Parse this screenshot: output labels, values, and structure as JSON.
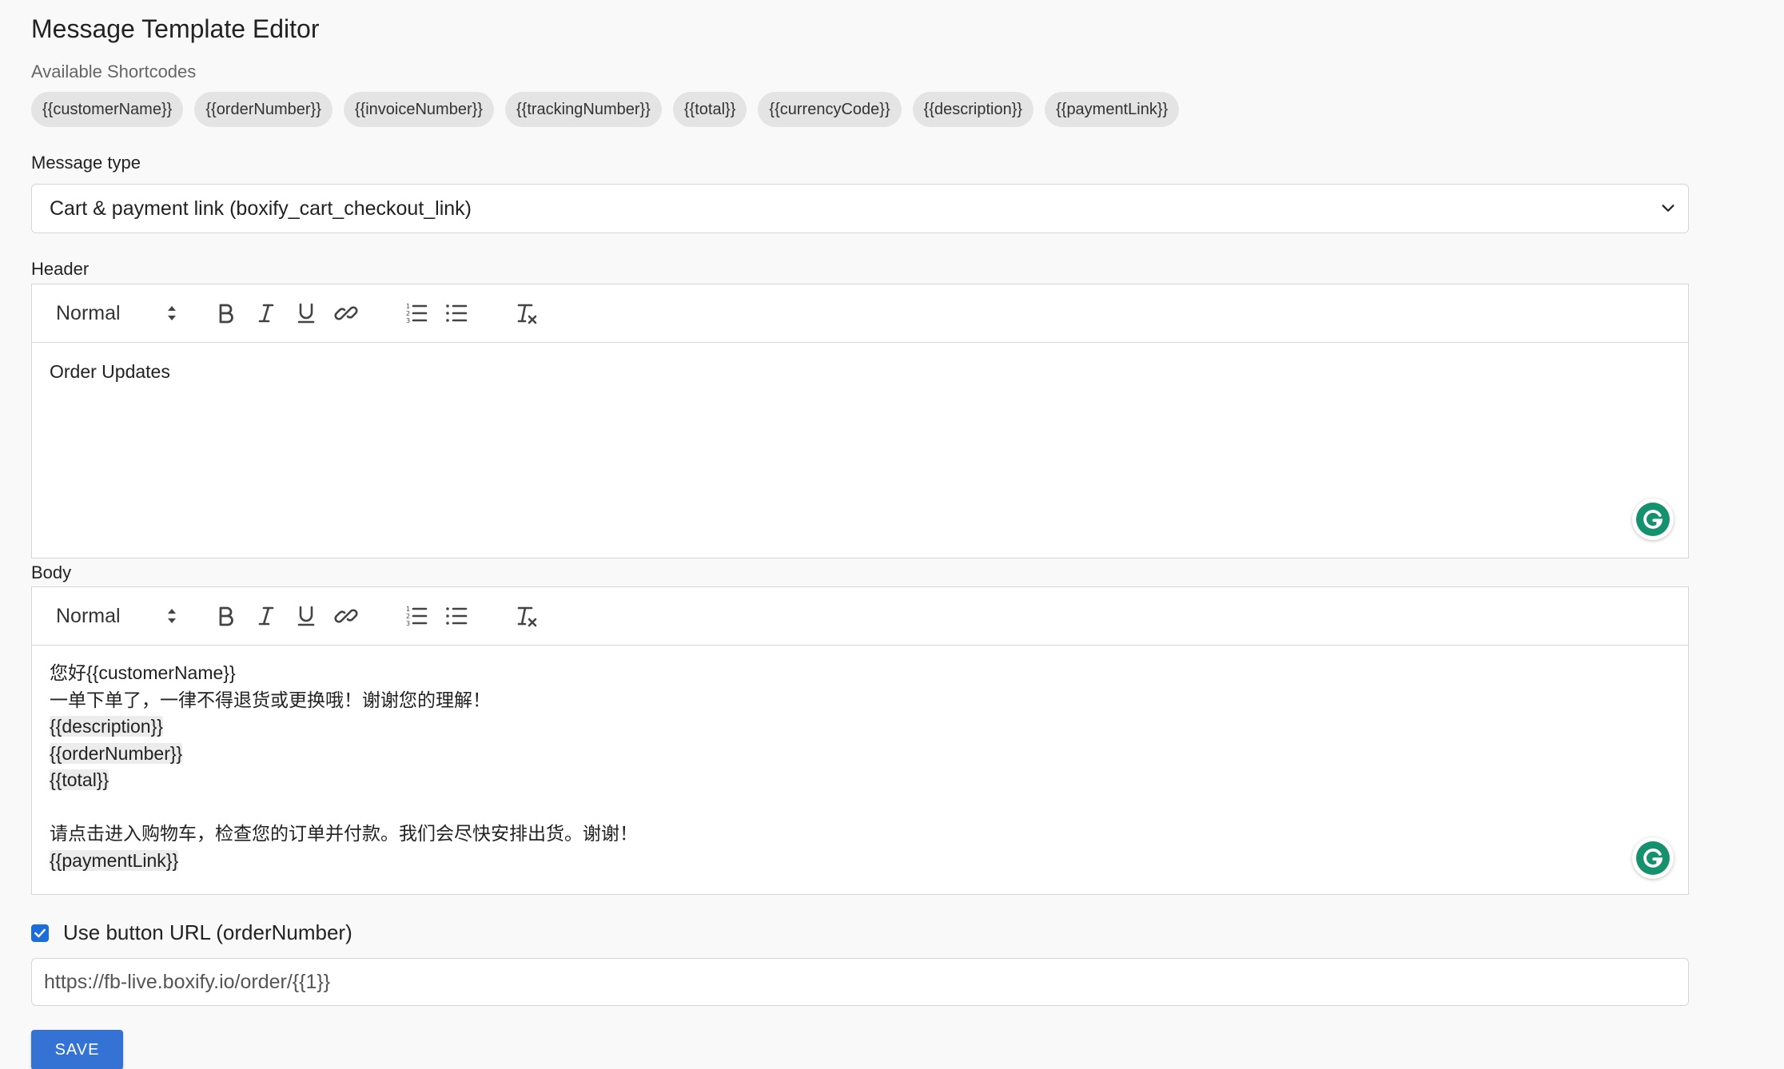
{
  "page": {
    "title": "Message Template Editor"
  },
  "shortcodes": {
    "label": "Available Shortcodes",
    "items": [
      "{{customerName}}",
      "{{orderNumber}}",
      "{{invoiceNumber}}",
      "{{trackingNumber}}",
      "{{total}}",
      "{{currencyCode}}",
      "{{description}}",
      "{{paymentLink}}"
    ]
  },
  "message_type": {
    "label": "Message type",
    "selected": "Cart & payment link (boxify_cart_checkout_link)"
  },
  "header_editor": {
    "label": "Header",
    "format_select": "Normal",
    "lines": [
      "Order Updates"
    ]
  },
  "body_editor": {
    "label": "Body",
    "format_select": "Normal",
    "lines": [
      "您好{{customerName}}",
      "一单下单了，一律不得退货或更换哦！谢谢您的理解！",
      "{{description}}",
      "{{orderNumber}}",
      "{{total}}",
      "",
      "请点击进入购物车，检查您的订单并付款。我们会尽快安排出货。谢谢！",
      "{{paymentLink}}"
    ]
  },
  "button_url": {
    "checkbox_label": "Use button URL (orderNumber)",
    "checked": true,
    "value": "https://fb-live.boxify.io/order/{{1}}"
  },
  "actions": {
    "save_label": "SAVE"
  },
  "colors": {
    "accent": "#3472d4",
    "checkbox": "#1a6ddb",
    "grammarly": "#15926d"
  }
}
